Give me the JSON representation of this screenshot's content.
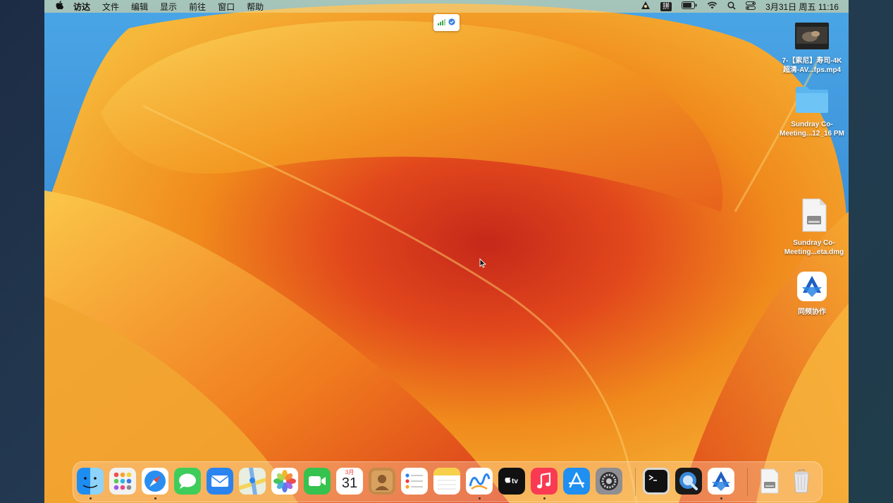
{
  "menubar": {
    "apple": "",
    "app_name": "访达",
    "items": [
      "文件",
      "编辑",
      "显示",
      "前往",
      "窗口",
      "帮助"
    ],
    "ime": "拼",
    "datetime": "3月31日 周五 11:16"
  },
  "desktop": {
    "video": "7-【索尼】寿司-4K\n超清-AV...fps.mp4",
    "folder": "Sundray Co-\nMeeting...12_16 PM",
    "dmg": "Sundray Co-\nMeeting...eta.dmg",
    "app": "同频协作"
  },
  "dock": {
    "calendar_month": "3月",
    "calendar_day": "31"
  },
  "colors": {
    "accent_orange": "#f08a1c",
    "accent_red": "#d2321c",
    "wallpaper_blue": "#3a8fd6"
  }
}
